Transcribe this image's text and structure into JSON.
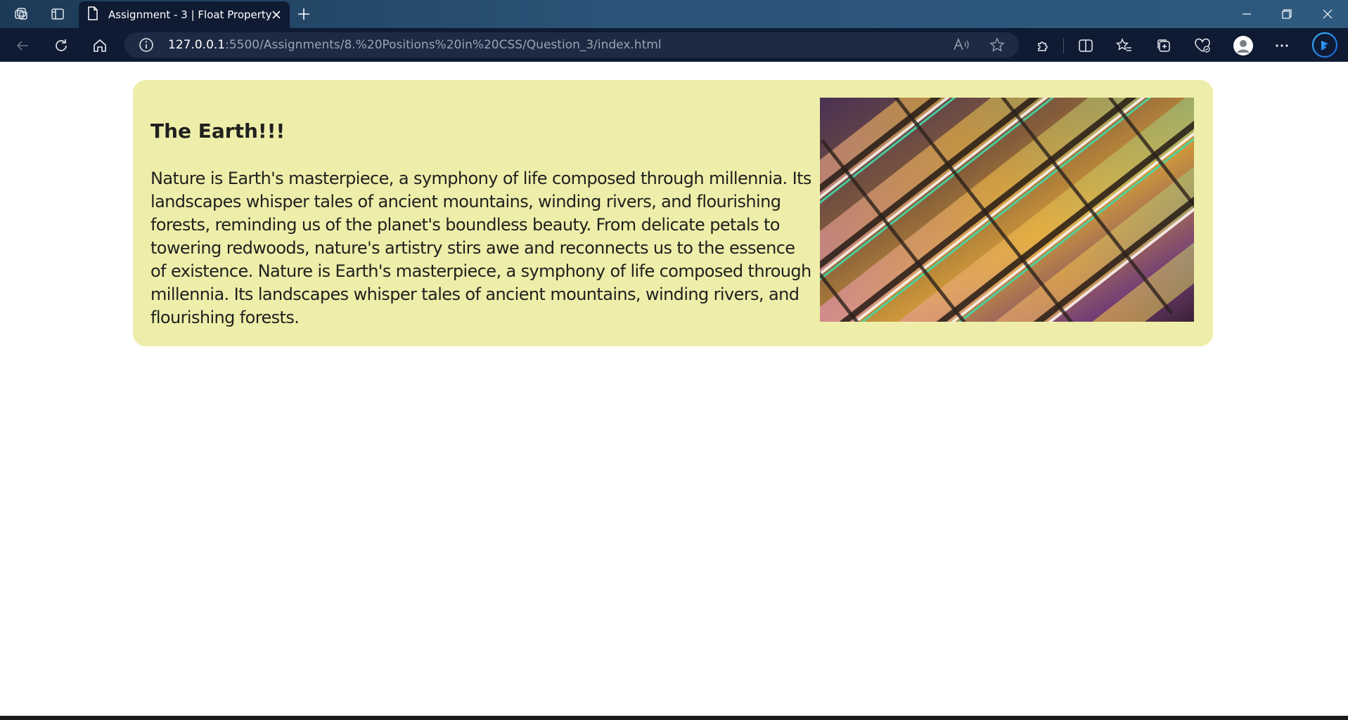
{
  "browser": {
    "tab": {
      "title": "Assignment - 3 | Float Property"
    },
    "address": {
      "host": "127.0.0.1",
      "rest": ":5500/Assignments/8.%20Positions%20in%20CSS/Question_3/index.html"
    }
  },
  "page": {
    "heading": "The Earth!!!",
    "paragraph": "Nature is Earth's masterpiece, a symphony of life composed through millennia. Its landscapes whisper tales of ancient mountains, winding rivers, and flourishing forests, reminding us of the planet's boundless beauty. From delicate petals to towering redwoods, nature's artistry stirs awe and reconnects us to the essence of existence. Nature is Earth's masterpiece, a symphony of life composed through millennia. Its landscapes whisper tales of ancient mountains, winding rivers, and flourishing forests.",
    "card_color": "#eeeeaa",
    "image": {
      "icon": "abstract-glass-architecture-image"
    }
  },
  "icons": {
    "workspaces": "workspaces-icon",
    "tab_actions": "tab-actions-icon",
    "page": "page-icon",
    "close": "close-icon",
    "new_tab": "plus-icon",
    "back": "back-arrow-icon",
    "refresh": "refresh-icon",
    "home": "home-icon",
    "info": "info-icon",
    "read_aloud": "read-aloud-icon",
    "favorite": "star-icon",
    "extensions": "puzzle-icon",
    "split": "split-screen-icon",
    "favorites": "favorites-icon",
    "collections": "collections-icon",
    "health": "browser-essentials-icon",
    "profile": "profile-icon",
    "more": "more-icon",
    "copilot": "copilot-icon"
  }
}
